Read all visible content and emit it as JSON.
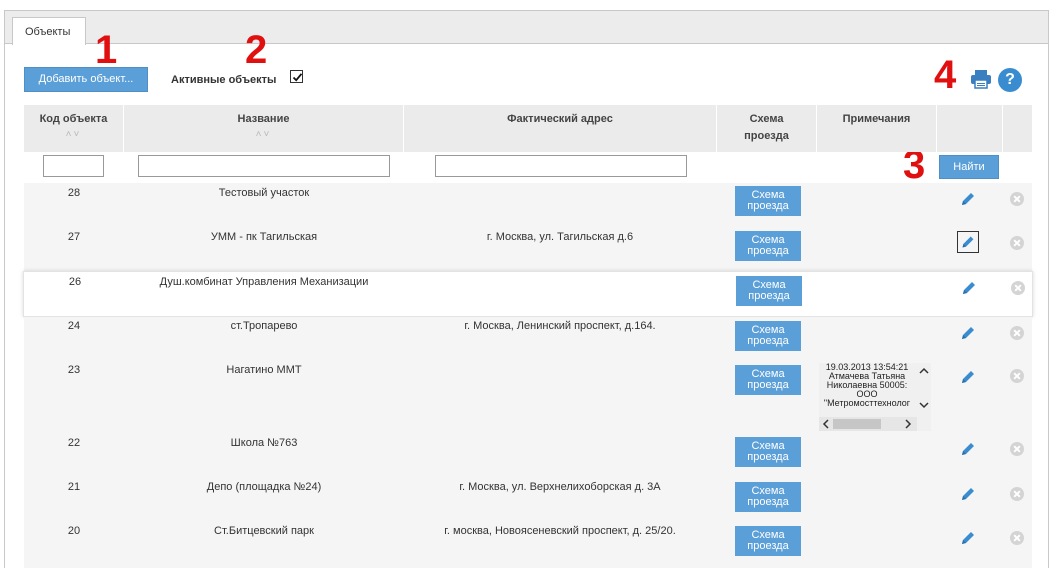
{
  "tabs": [
    {
      "label": "Объекты"
    }
  ],
  "markers": [
    "1",
    "2",
    "3",
    "4"
  ],
  "toolbar": {
    "add_label": "Добавить объект...",
    "active_label": "Активные объекты",
    "active_checked": true,
    "find_label": "Найти",
    "help_label": "?"
  },
  "table": {
    "headers": {
      "code": "Код объекта",
      "name": "Название",
      "address": "Фактический адрес",
      "scheme": "Схема проезда",
      "notes": "Примечания"
    },
    "sort_glyph": "˄˅",
    "scheme_button": "Схема проезда",
    "rows": [
      {
        "code": "28",
        "name": "Тестовый участок",
        "address": ""
      },
      {
        "code": "27",
        "name": "УММ - пк Тагильская",
        "address": "г. Москва, ул. Тагильская д.6"
      },
      {
        "code": "26",
        "name": "Душ.комбинат Управления Механизации",
        "address": ""
      },
      {
        "code": "24",
        "name": "ст.Тропарево",
        "address": "г. Москва, Ленинский проспект, д.164."
      },
      {
        "code": "23",
        "name": "Нагатино ММТ",
        "address": "",
        "note": "19.03.2013 13:54:21\nАтмачева Татьяна\nНиколаевна 50005:\nООО\n\"Метромосттехнолог"
      },
      {
        "code": "22",
        "name": "Школа №763",
        "address": ""
      },
      {
        "code": "21",
        "name": "Депо (площадка №24)",
        "address": "г. Москва, ул. Верхнелихоборская д. 3А"
      },
      {
        "code": "20",
        "name": "Ст.Битцевский парк",
        "address": "г. москва, Новоясеневский проспект, д. 25/20."
      }
    ]
  },
  "colors": {
    "accent": "#5b9fd8",
    "marker": "#e01010",
    "header_bg": "#ebebeb"
  }
}
